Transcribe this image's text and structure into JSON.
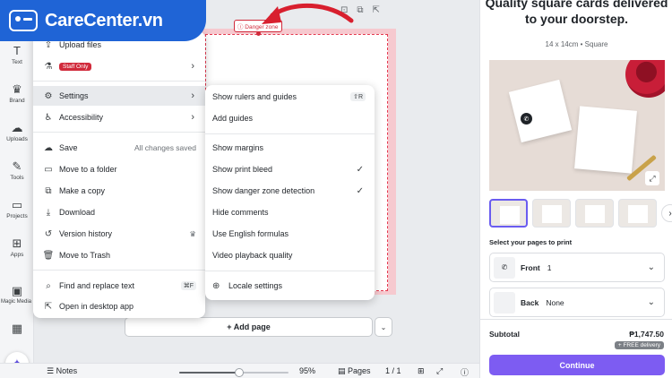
{
  "brand": {
    "name": "CareCenter.vn",
    "color": "#1f64d6"
  },
  "rail": [
    {
      "label": "Text",
      "icon": "T"
    },
    {
      "label": "Brand",
      "icon": "♛"
    },
    {
      "label": "Uploads",
      "icon": "☁"
    },
    {
      "label": "Tools",
      "icon": "✎"
    },
    {
      "label": "Projects",
      "icon": "▭"
    },
    {
      "label": "Apps",
      "icon": "⊞"
    },
    {
      "label": "Magic Media",
      "icon": "▣"
    }
  ],
  "canvas": {
    "danger_label": "ⓘ Danger zone",
    "add_page": "+ Add page",
    "danger_color": "#d12a3b"
  },
  "menu": {
    "upload_files": "Upload files",
    "staff_only": "Staff Only",
    "settings": "Settings",
    "accessibility": "Accessibility",
    "save": "Save",
    "save_status": "All changes saved",
    "move_folder": "Move to a folder",
    "make_copy": "Make a copy",
    "download": "Download",
    "version_history": "Version history",
    "move_trash": "Move to Trash",
    "find_replace": "Find and replace text",
    "find_replace_shortcut": "⌘F",
    "open_desktop": "Open in desktop app"
  },
  "submenu": {
    "rulers": "Show rulers and guides",
    "rulers_shortcut": "⇧R",
    "add_guides": "Add guides",
    "margins": "Show margins",
    "print_bleed": "Show print bleed",
    "danger_detect": "Show danger zone detection",
    "hide_comments": "Hide comments",
    "english_formulas": "Use English formulas",
    "video_quality": "Video playback quality",
    "locale": "Locale settings"
  },
  "bottombar": {
    "notes": "Notes",
    "zoom": "95%",
    "zoom_fraction": 0.55,
    "pages": "Pages",
    "page_count": "1 / 1"
  },
  "panel": {
    "title": "Quality square cards delivered to your doorstep.",
    "size": "14 x 14cm • Square",
    "select_label": "Select your pages to print",
    "front_label": "Front",
    "front_value": "1",
    "back_label": "Back",
    "back_value": "None",
    "subtotal_label": "Subtotal",
    "subtotal_value": "₱1,747.50",
    "free_delivery": "+ FREE delivery",
    "continue": "Continue",
    "accent": "#7d5cf2"
  }
}
